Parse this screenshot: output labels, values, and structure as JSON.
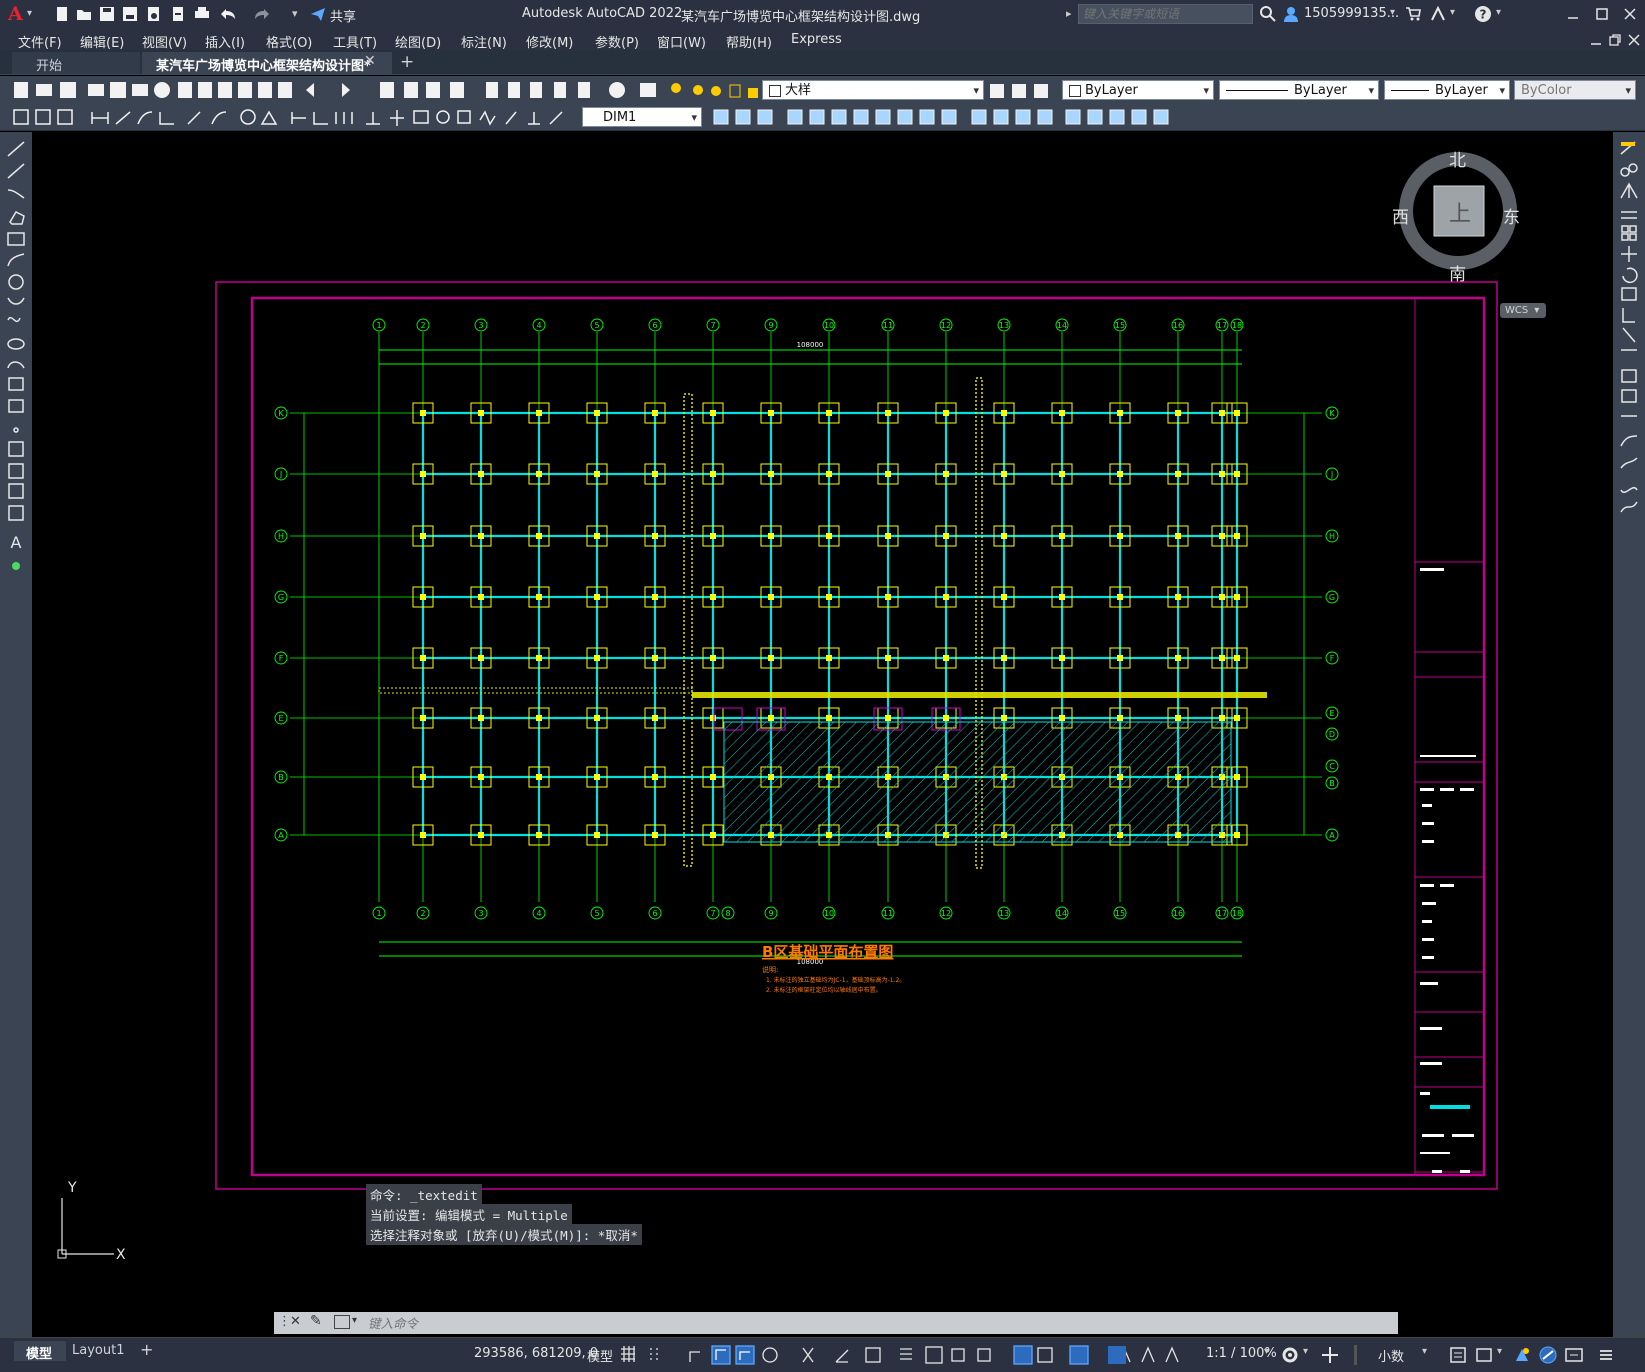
{
  "title_bar": {
    "app_name": "Autodesk AutoCAD 2022",
    "file_name": "某汽车广场博览中心框架结构设计图.dwg",
    "share_label": "共享",
    "search_placeholder": "键入关键字或短语",
    "user": "1505999135...",
    "logo_letter": "A"
  },
  "menu": [
    "文件(F)",
    "编辑(E)",
    "视图(V)",
    "插入(I)",
    "格式(O)",
    "工具(T)",
    "绘图(D)",
    "标注(N)",
    "修改(M)",
    "参数(P)",
    "窗口(W)",
    "帮助(H)",
    "Express"
  ],
  "tabs": {
    "start": "开始",
    "active": "某汽车广场博览中心框架结构设计图*",
    "add": "+"
  },
  "toolbar": {
    "layer_value": "大样",
    "color_value": "ByLayer",
    "linetype_value": "ByLayer",
    "lineweight_value": "ByLayer",
    "plotstyle_value": "ByColor",
    "dimstyle_value": "DIM1"
  },
  "viewcube": {
    "north": "北",
    "south": "南",
    "east": "东",
    "west": "西",
    "face": "上",
    "wcs": "WCS"
  },
  "ucs": {
    "x": "X",
    "y": "Y"
  },
  "drawing": {
    "title": "B区基础平面布置图",
    "note_head": "说明:",
    "note_1": "1. 未标注的独立基础均为JC-1，基础顶标高为-1.2。",
    "note_2": "2. 未标注的框架柱定位均以轴线居中布置。",
    "grid_cols_top": [
      "1",
      "2",
      "3",
      "4",
      "5",
      "6",
      "7",
      "9",
      "10",
      "11",
      "12",
      "13",
      "14",
      "15",
      "16",
      "17",
      "18"
    ],
    "grid_cols_bottom": [
      "1",
      "2",
      "3",
      "4",
      "5",
      "6",
      "7",
      "8",
      "9",
      "10",
      "11",
      "12",
      "13",
      "14",
      "15",
      "16",
      "17",
      "18"
    ],
    "grid_rows_left": [
      "K",
      "J",
      "H",
      "G",
      "F",
      "E",
      "B",
      "A"
    ],
    "grid_rows_right": [
      "K",
      "J",
      "H",
      "G",
      "F",
      "E",
      "D",
      "C",
      "B",
      "A"
    ],
    "total_dim_label": "108000"
  },
  "command": {
    "line1": "命令: _textedit",
    "line2": "当前设置: 编辑模式 = Multiple",
    "line3": "选择注释对象或 [放弃(U)/模式(M)]: *取消*",
    "placeholder": "键入命令"
  },
  "status": {
    "model_tab": "模型",
    "layout_tab": "Layout1",
    "coords": "293586, 681209, 0",
    "model_label": "模型",
    "scale": "1:1 / 100%",
    "units": "小数"
  },
  "colors": {
    "grid_green": "#00ff00",
    "beam_cyan": "#00e0e0",
    "frame_magenta": "#c0008c",
    "column_yellow": "#ffff00",
    "title_orange": "#ff7a00"
  }
}
